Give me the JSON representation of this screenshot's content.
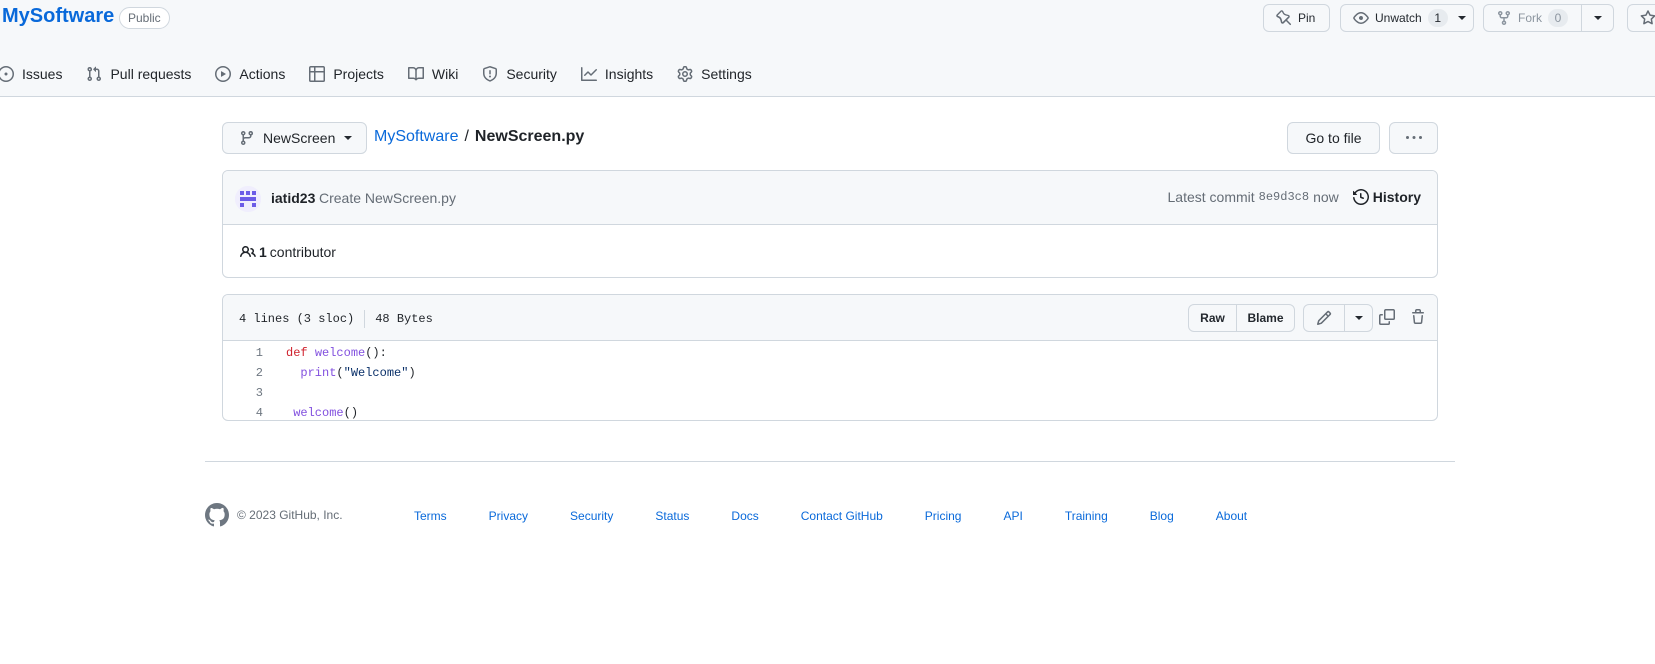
{
  "repo": {
    "name": "MySoftware",
    "visibility": "Public"
  },
  "header_actions": {
    "pin": "Pin",
    "unwatch": "Unwatch",
    "watch_count": "1",
    "fork": "Fork",
    "fork_count": "0"
  },
  "nav": {
    "items": [
      {
        "label": "Issues",
        "icon": "issue-icon"
      },
      {
        "label": "Pull requests",
        "icon": "pull-request-icon"
      },
      {
        "label": "Actions",
        "icon": "play-icon"
      },
      {
        "label": "Projects",
        "icon": "table-icon"
      },
      {
        "label": "Wiki",
        "icon": "book-icon"
      },
      {
        "label": "Security",
        "icon": "shield-icon"
      },
      {
        "label": "Insights",
        "icon": "graph-icon"
      },
      {
        "label": "Settings",
        "icon": "gear-icon"
      }
    ]
  },
  "branch": {
    "name": "NewScreen"
  },
  "breadcrumb": {
    "repo": "MySoftware",
    "separator": "/",
    "file": "NewScreen.py"
  },
  "file_actions": {
    "go_to_file": "Go to file"
  },
  "commit": {
    "author": "iatid23",
    "message": "Create NewScreen.py",
    "latest_label": "Latest commit",
    "sha": "8e9d3c8",
    "time": "now",
    "history": "History"
  },
  "contributors": {
    "count": "1",
    "label": "contributor"
  },
  "file": {
    "lines_info": "4 lines (3 sloc)",
    "size": "48 Bytes",
    "raw": "Raw",
    "blame": "Blame",
    "code": [
      {
        "num": "1",
        "text": "def welcome():"
      },
      {
        "num": "2",
        "text": "  print(\"Welcome\")"
      },
      {
        "num": "3",
        "text": ""
      },
      {
        "num": "4",
        "text": " welcome()"
      }
    ]
  },
  "footer": {
    "copyright": "© 2023 GitHub, Inc.",
    "links": [
      "Terms",
      "Privacy",
      "Security",
      "Status",
      "Docs",
      "Contact GitHub",
      "Pricing",
      "API",
      "Training",
      "Blog",
      "About"
    ]
  },
  "colors": {
    "accent": "#0969da",
    "border": "#d0d7de",
    "canvas_subtle": "#f6f8fa"
  }
}
